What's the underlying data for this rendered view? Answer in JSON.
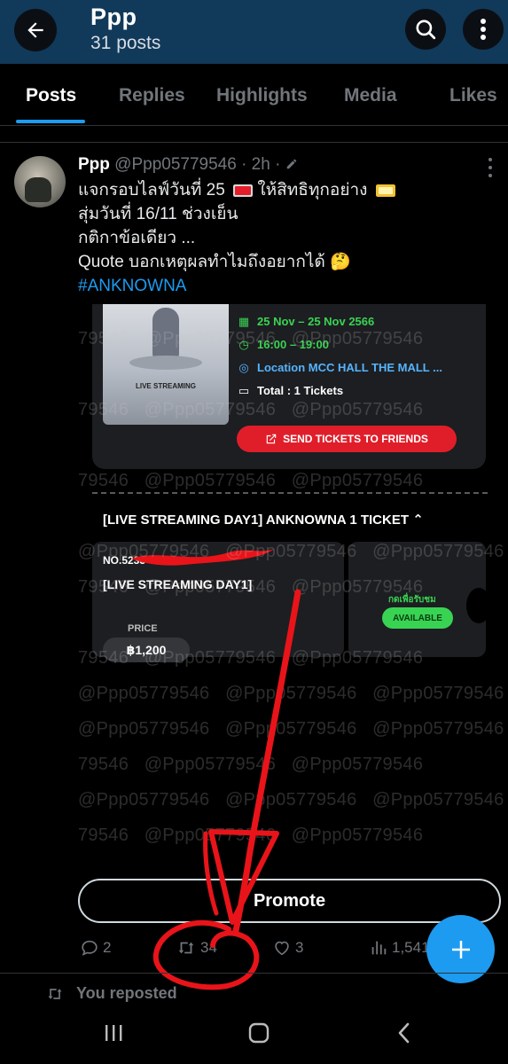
{
  "header": {
    "title": "Ppp",
    "subtitle": "31 posts"
  },
  "tabs": [
    {
      "label": "Posts",
      "active": true
    },
    {
      "label": "Replies",
      "active": false
    },
    {
      "label": "Highlights",
      "active": false
    },
    {
      "label": "Media",
      "active": false
    },
    {
      "label": "Likes",
      "active": false
    }
  ],
  "post": {
    "display_name": "Ppp",
    "handle_time": "@Ppp05779546 · 2h ·",
    "lines": [
      "แจกรอบไลฟ์วันที่ 25",
      "ให้สิทธิทุกอย่าง",
      "สุ่มวันที่ 16/11 ช่วงเย็น",
      "กติกาข้อเดียว ...",
      "Quote บอกเหตุผลทำไมถึงอยากได้"
    ],
    "emoji_thinking": "🤔",
    "hashtag": "#ANKNOWNA"
  },
  "ticket": {
    "dates": "25 Nov – 25 Nov 2566",
    "time": "16:00 – 19:00",
    "location": "Location MCC HALL THE MALL ...",
    "total": "Total : 1 Tickets",
    "send_button": "SEND TICKETS TO FRIENDS",
    "section_header": "[LIVE STREAMING DAY1] ANKNOWNA   1 TICKET",
    "number": "NO.5233",
    "name": "[LIVE STREAMING DAY1]",
    "price_label": "PRICE",
    "price": "฿1,200",
    "redeem_label": "กดเพื่อรับชม",
    "status": "AVAILABLE",
    "poster_title": "LIVE STREAMING"
  },
  "watermark": "@Ppp05779546",
  "watermark_partial": "79546",
  "promote_label": "Promote",
  "actions": {
    "replies": "2",
    "reposts": "34",
    "likes": "3",
    "views": "1,541"
  },
  "next_post": {
    "reposted_label": "You reposted"
  },
  "colors": {
    "header_bg": "#11395a",
    "accent": "#1d9bf0",
    "annotation_red": "#e8141a",
    "available_green": "#39d353",
    "send_red": "#e01e2a"
  },
  "icons": [
    "back-arrow-icon",
    "search-icon",
    "more-vertical-icon",
    "edit-icon",
    "ticket-icon",
    "reply-icon",
    "repost-icon",
    "like-icon",
    "views-icon",
    "plus-icon",
    "recents-icon",
    "home-icon",
    "back-icon"
  ]
}
